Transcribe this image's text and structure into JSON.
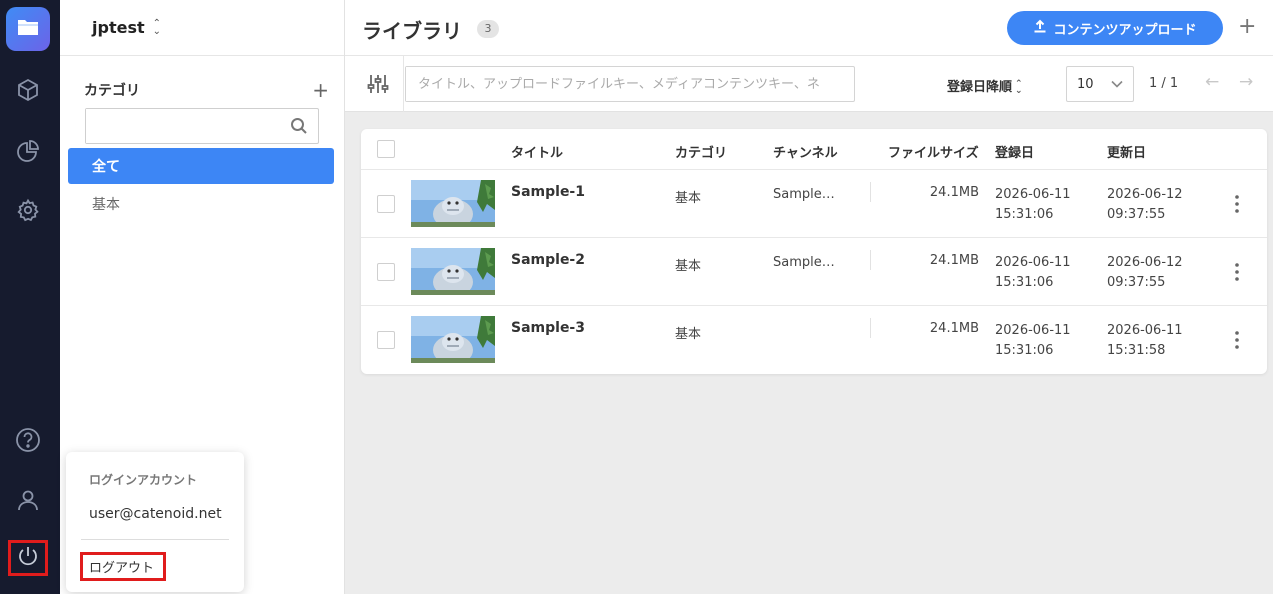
{
  "workspace": {
    "name": "jptest"
  },
  "rail": {
    "icons": [
      "folder-icon",
      "cube-icon",
      "pie-chart-icon",
      "gear-icon",
      "help-icon",
      "user-icon",
      "power-icon"
    ]
  },
  "categories": {
    "title": "カテゴリ",
    "search_placeholder": "",
    "items": [
      {
        "label": "全て",
        "active": true
      },
      {
        "label": "基本",
        "active": false
      }
    ]
  },
  "account_popup": {
    "title": "ログインアカウント",
    "email": "user@catenoid.net",
    "logout_label": "ログアウト"
  },
  "header": {
    "title": "ライブラリ",
    "count": "3",
    "upload_label": "コンテンツアップロード"
  },
  "toolbar": {
    "search_placeholder": "タイトル、アップロードファイルキー、メディアコンテンツキー、ネ",
    "sort_label": "登録日降順",
    "page_size": "10",
    "pager": "1 / 1"
  },
  "table": {
    "headers": {
      "title": "タイトル",
      "category": "カテゴリ",
      "channel": "チャンネル",
      "size": "ファイルサイズ",
      "created": "登録日",
      "updated": "更新日"
    },
    "rows": [
      {
        "title": "Sample-1",
        "category": "基本",
        "channel": "Sample…",
        "size": "24.1MB",
        "created_date": "2026-06-11",
        "created_time": "15:31:06",
        "updated_date": "2026-06-12",
        "updated_time": "09:37:55"
      },
      {
        "title": "Sample-2",
        "category": "基本",
        "channel": "Sample…",
        "size": "24.1MB",
        "created_date": "2026-06-11",
        "created_time": "15:31:06",
        "updated_date": "2026-06-12",
        "updated_time": "09:37:55"
      },
      {
        "title": "Sample-3",
        "category": "基本",
        "channel": "",
        "size": "24.1MB",
        "created_date": "2026-06-11",
        "created_time": "15:31:06",
        "updated_date": "2026-06-11",
        "updated_time": "15:31:58"
      }
    ]
  },
  "colors": {
    "accent": "#3d86f5",
    "rail_bg": "#161b2e",
    "highlight_box": "#e01c1c"
  }
}
